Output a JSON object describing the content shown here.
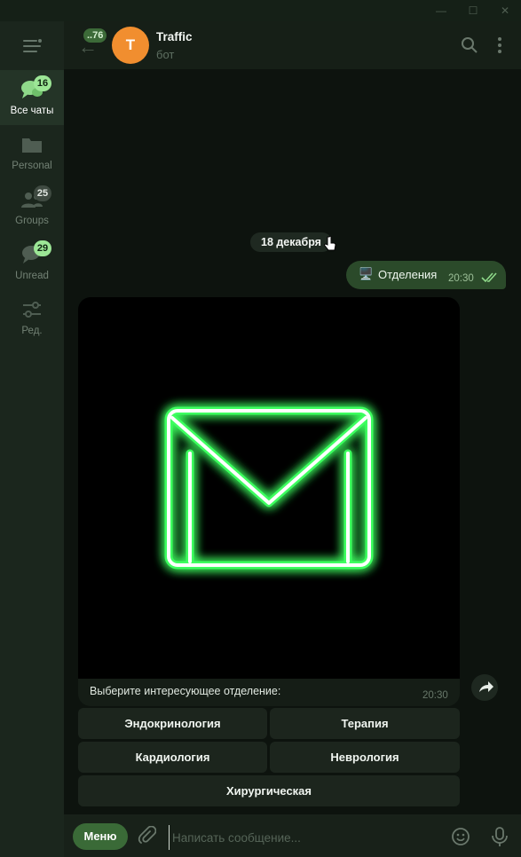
{
  "window": {
    "minimize_icon": "minimize-icon",
    "maximize_icon": "maximize-icon",
    "close_icon": "close-icon"
  },
  "sidebar": {
    "menu_icon": "hamburger-menu-icon",
    "folders": [
      {
        "label": "Все чаты",
        "badge": "16",
        "badge_style": "green",
        "active": true,
        "icon": "chats-icon"
      },
      {
        "label": "Personal",
        "badge": "",
        "badge_style": "",
        "active": false,
        "icon": "folder-icon"
      },
      {
        "label": "Groups",
        "badge": "25",
        "badge_style": "gray",
        "active": false,
        "icon": "users-icon"
      },
      {
        "label": "Unread",
        "badge": "29",
        "badge_style": "green",
        "active": false,
        "icon": "chat-bubble-icon"
      },
      {
        "label": "Ред.",
        "badge": "",
        "badge_style": "",
        "active": false,
        "icon": "sliders-icon"
      }
    ]
  },
  "header": {
    "back_badge": "..76",
    "avatar_letter": "T",
    "title": "Traffic",
    "subtitle": "бот",
    "avatar_color": "#f18e2f"
  },
  "messages": {
    "date": "18 декабря",
    "outgoing": {
      "emoji": "🖥️",
      "text": "Отделения",
      "time": "20:30"
    },
    "incoming": {
      "image": "neon-envelope-image",
      "caption": "Выберите интересующее отделение:",
      "time": "20:30"
    },
    "keyboard": [
      [
        "Эндокринология",
        "Терапия"
      ],
      [
        "Кардиология",
        "Неврология"
      ],
      [
        "Хирургическая"
      ]
    ]
  },
  "composer": {
    "menu_label": "Меню",
    "placeholder": "Написать сообщение..."
  },
  "colors": {
    "accent": "#9ce696",
    "bubble_out": "#2b4a2a",
    "neon": "#39ff5a"
  }
}
